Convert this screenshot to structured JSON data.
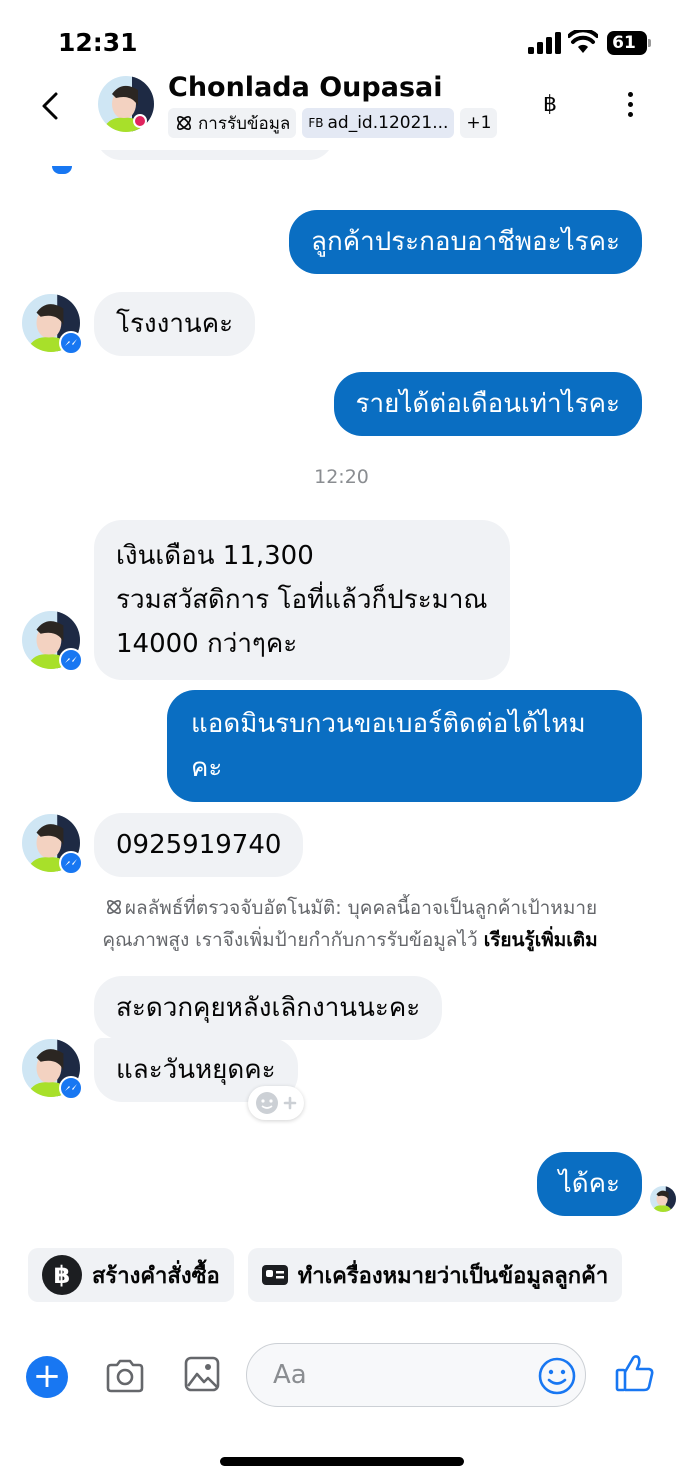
{
  "status_bar": {
    "time": "12:31",
    "battery": "61"
  },
  "header": {
    "contact_name": "Chonlada Oupasai",
    "tag_lead": "การรับข้อมูล",
    "tag_ad_prefix": "FB",
    "tag_ad": "ad_id.12021...",
    "tag_more": "+1",
    "currency_icon": "฿"
  },
  "messages": [
    {
      "side": "out",
      "text": "ลูกค้าประกอบอาชีพอะไรคะ"
    },
    {
      "side": "in",
      "text": "โรงงานคะ"
    },
    {
      "side": "out",
      "text": "รายได้ต่อเดือนเท่าไรคะ"
    },
    {
      "side": "in",
      "line1": "เงินเดือน 11,300",
      "line2": "รวมสวัสดิการ โอที่แล้วก็ประมาณ",
      "line3": "14000 กว่าๆคะ"
    },
    {
      "side": "out",
      "line1": "แอดมินรบกวนขอเบอร์ติดต่อได้ไหม",
      "line2": "คะ"
    },
    {
      "side": "in",
      "text": "0925919740"
    },
    {
      "side": "in",
      "text": "สะดวกคุยหลังเลิกงานนะคะ"
    },
    {
      "side": "in",
      "text": "และวันหยุดคะ"
    },
    {
      "side": "out",
      "text": "ได้คะ"
    }
  ],
  "timestamp": "12:20",
  "notice": {
    "line1": "ผลลัพธ์ที่ตรวจจับอัตโนมัติ: บุคคลนี้อาจเป็นลูกค้าเป้าหมาย",
    "line2": "คุณภาพสูง เราจึงเพิ่มป้ายกำกับการรับข้อมูลไว้ ",
    "learn_more": "เรียนรู้เพิ่มเติม"
  },
  "quick_actions": {
    "create_order": "สร้างคำสั่งซื้อ",
    "create_order_icon": "฿",
    "mark_as_lead": "ทำเครื่องหมายว่าเป็นข้อมูลลูกค้า"
  },
  "composer": {
    "placeholder": "Aa"
  },
  "colors": {
    "outgoing": "#0a6ec2",
    "incoming": "#f0f2f5",
    "accent": "#1877f2"
  }
}
